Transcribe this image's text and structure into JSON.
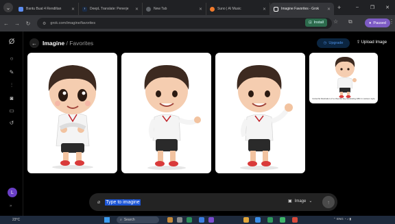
{
  "browser": {
    "tabs": [
      {
        "title": "Bantu Buat 4 Rendiltan",
        "color": "#5c8df0",
        "active": false
      },
      {
        "title": "DeepL Translate: Penerje",
        "color": "#1a2b45",
        "active": false
      },
      {
        "title": "New Tab",
        "color": "#5f6368",
        "active": false
      },
      {
        "title": "Suno | AI Music",
        "color": "#f07a2b",
        "active": false
      },
      {
        "title": "Imagine Favorites - Grok",
        "color": "#ffffff",
        "active": true
      }
    ],
    "new_tab_glyph": "+",
    "url": "grok.com/imagine/favorites",
    "install_label": "Install",
    "profile_label": "Paused"
  },
  "header": {
    "section": "Imagine",
    "separator": " / ",
    "page": "Favorites",
    "upgrade_label": "Upgrade",
    "upload_label": "Upload Image"
  },
  "sidebar": {
    "avatar_letter": "L",
    "icons": [
      "grok-logo-icon",
      "search-icon",
      "edit-icon",
      "voice-icon",
      "imagine-icon",
      "folder-icon",
      "history-icon"
    ]
  },
  "gallery": {
    "items": [
      {
        "pose": "hands-together"
      },
      {
        "pose": "presenting"
      },
      {
        "pose": "waving"
      },
      {
        "pose": "thumbs-up",
        "caption": "Colourful illustration of a cheerful boy illustrating ABC in cartoon style"
      }
    ]
  },
  "composer": {
    "placeholder": "Type to imagine",
    "mode_label": "Image"
  },
  "taskbar": {
    "weather": "23°C",
    "search_label": "Search",
    "tray": "ENG"
  },
  "colors": {
    "accent_blue": "#1c55d6",
    "upgrade_text": "#4c91e8",
    "avatar": "#6a3fc6"
  }
}
